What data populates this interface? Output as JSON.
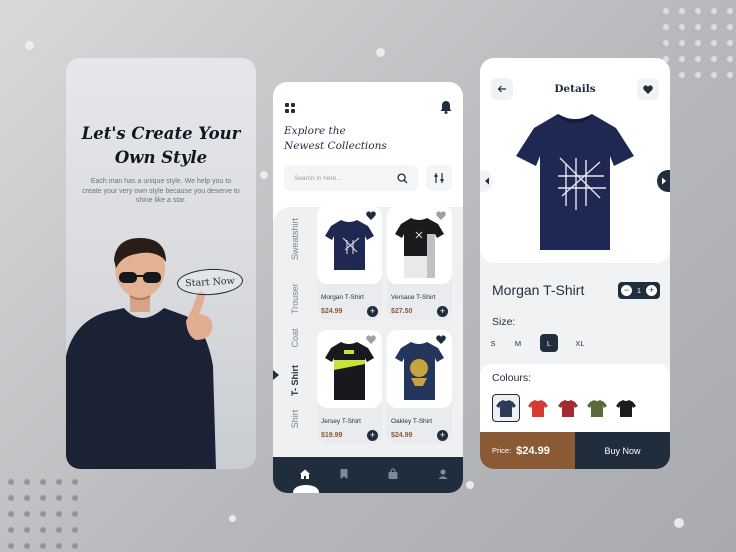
{
  "colors": {
    "navy": "#1f2d3d",
    "brown": "#8a5a35",
    "bg": "#c4c5c8"
  },
  "onboarding": {
    "headline_line1": "Let's Create Your",
    "headline_line2": "Own Style",
    "body": "Each man has a unique style. We help you to create your very own style because you deserve to shine like a star.",
    "cta": "Start Now"
  },
  "home": {
    "title_line1": "Explore the",
    "title_line2": "Newest Collections",
    "search_placeholder": "Search in here...",
    "categories": [
      "Sweatshirt",
      "Trouser",
      "Coat",
      "T- Shirt",
      "Shirt"
    ],
    "active_category": "T- Shirt",
    "products": [
      {
        "name": "Morgan T-Shirt",
        "price": "$24.99"
      },
      {
        "name": "Versace T-Shirt",
        "price": "$27.50"
      },
      {
        "name": "Jersey T-Shirt",
        "price": "$19.99"
      },
      {
        "name": "Oakley T-Shirt",
        "price": "$24.99"
      }
    ],
    "tabs": [
      "home-icon",
      "bookmark-icon",
      "bag-icon",
      "profile-icon"
    ]
  },
  "details": {
    "header": "Details",
    "product_name": "Morgan T-Shirt",
    "quantity": "1",
    "size_label": "Size:",
    "sizes": [
      "S",
      "M",
      "L",
      "XL"
    ],
    "selected_size": "L",
    "colours_label": "Colours:",
    "colours": [
      "#2d3b57",
      "#d63a34",
      "#a32a2e",
      "#5c6a3a",
      "#1c1c1e"
    ],
    "price_label": "Price:",
    "price": "$24.99",
    "buy_label": "Buy Now"
  }
}
